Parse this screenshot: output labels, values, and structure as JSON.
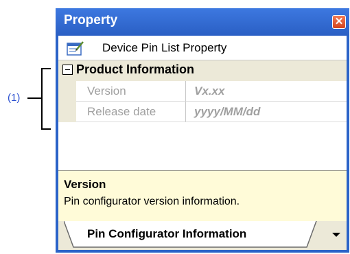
{
  "callout": {
    "label": "(1)"
  },
  "window": {
    "title": "Property",
    "close_glyph": "✕"
  },
  "header": {
    "icon": "property-page-icon",
    "text": "Device Pin List Property"
  },
  "category": {
    "expander_state": "expanded",
    "label": "Product Information"
  },
  "properties": [
    {
      "name": "Version",
      "value": "Vx.xx"
    },
    {
      "name": "Release date",
      "value": "yyyy/MM/dd"
    }
  ],
  "description": {
    "title": "Version",
    "text": "Pin configurator version information."
  },
  "tabs": [
    {
      "label": "Pin Configurator Information",
      "active": true
    }
  ],
  "colors": {
    "titlebar": "#2b63c8",
    "category_bg": "#ece9d8",
    "description_bg": "#fffbd8",
    "callout": "#2a4fd0"
  }
}
